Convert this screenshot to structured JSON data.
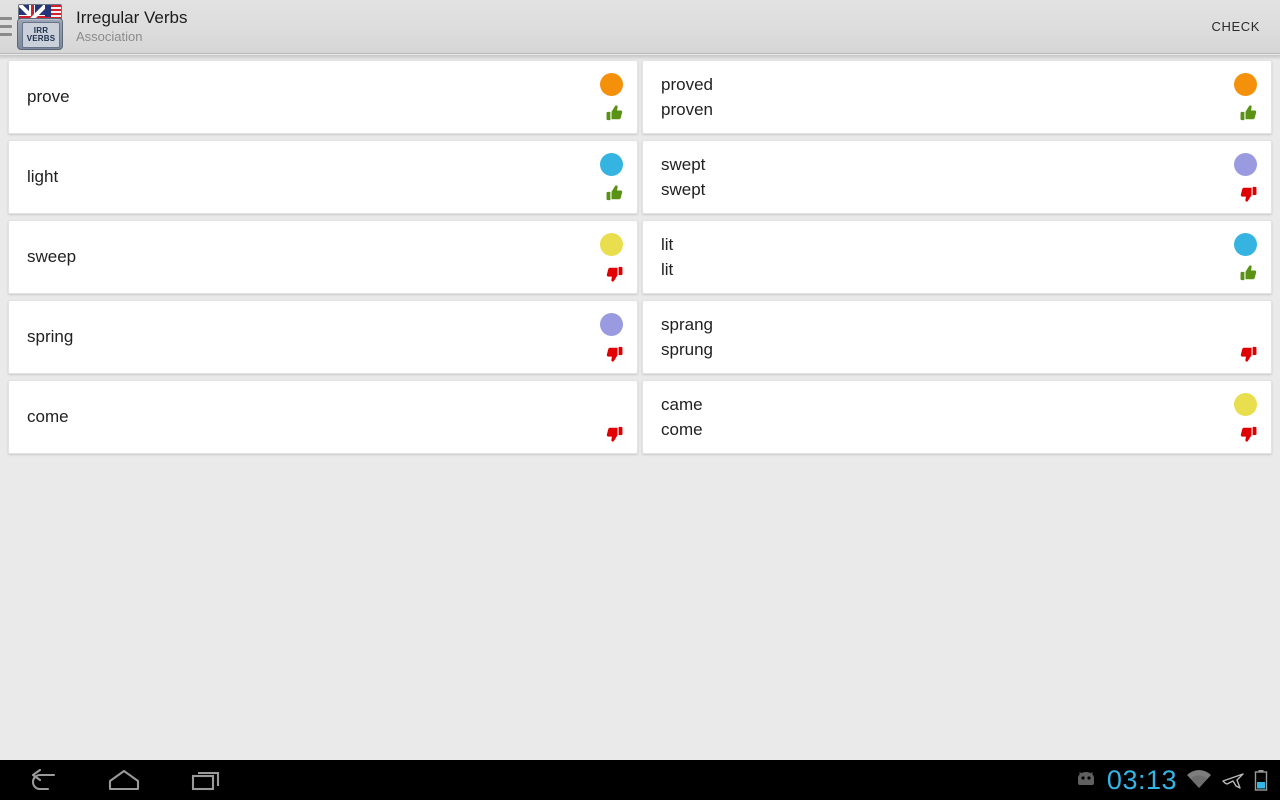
{
  "actionbar": {
    "drawer_icon": "hamburger-menu-icon",
    "app_icon": "irregular-verbs-app-icon",
    "app_icon_plate_line1": "IRR",
    "app_icon_plate_line2": "VERBS",
    "title": "Irregular Verbs",
    "subtitle": "Association",
    "check_label": "CHECK"
  },
  "colors": {
    "orange": "#f5900b",
    "cyan": "#35b4e2",
    "yellow": "#e9de4e",
    "purple": "#9a9ae0",
    "thumb_up": "#5a9216",
    "thumb_down": "#e00000",
    "accent": "#33b5e5",
    "page_bg": "#eaeaea",
    "card_bg": "#ffffff",
    "actionbar_bg": "#dcdcdc"
  },
  "rows": [
    {
      "left": {
        "words": [
          "prove"
        ],
        "dot": "#f5900b",
        "mark": "thumb-up"
      },
      "right": {
        "words": [
          "proved",
          "proven"
        ],
        "dot": "#f5900b",
        "mark": "thumb-up"
      }
    },
    {
      "left": {
        "words": [
          "light"
        ],
        "dot": "#35b4e2",
        "mark": "thumb-up"
      },
      "right": {
        "words": [
          "swept",
          "swept"
        ],
        "dot": "#9a9ae0",
        "mark": "thumb-down"
      }
    },
    {
      "left": {
        "words": [
          "sweep"
        ],
        "dot": "#e9de4e",
        "mark": "thumb-down"
      },
      "right": {
        "words": [
          "lit",
          "lit"
        ],
        "dot": "#35b4e2",
        "mark": "thumb-up"
      }
    },
    {
      "left": {
        "words": [
          "spring"
        ],
        "dot": "#9a9ae0",
        "mark": "thumb-down"
      },
      "right": {
        "words": [
          "sprang",
          "sprung"
        ],
        "dot": null,
        "mark": "thumb-down"
      }
    },
    {
      "left": {
        "words": [
          "come"
        ],
        "dot": null,
        "mark": "thumb-down"
      },
      "right": {
        "words": [
          "came",
          "come"
        ],
        "dot": "#e9de4e",
        "mark": "thumb-down"
      }
    }
  ],
  "navbar": {
    "back_icon": "back-arrow-icon",
    "home_icon": "home-icon",
    "recents_icon": "recent-apps-icon",
    "android_icon": "android-robot-icon",
    "clock": "03:13",
    "wifi_icon": "wifi-icon",
    "airplane_icon": "airplane-mode-icon",
    "battery_icon": "battery-icon"
  }
}
